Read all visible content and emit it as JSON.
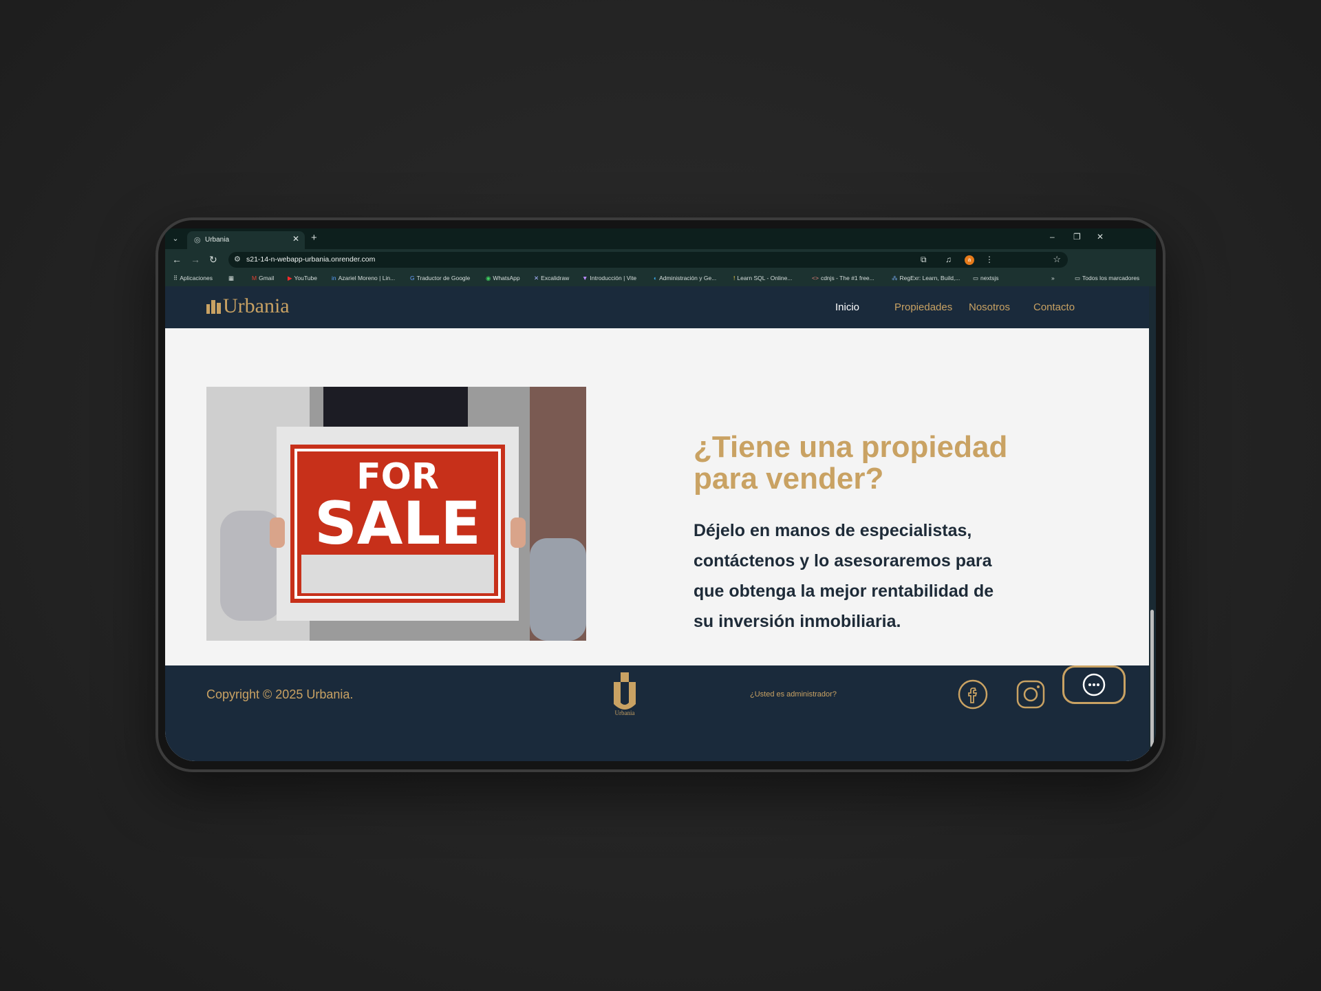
{
  "browser": {
    "tab_title": "Urbania",
    "url": "s21-14-n-webapp-urbania.onrender.com",
    "profile_initial": "a",
    "bookmarks": [
      "Aplicaciones",
      "Gmail",
      "YouTube",
      "Azariel Moreno | Lin...",
      "Traductor de Google",
      "WhatsApp",
      "Excalidraw",
      "Introducción | Vite",
      "Administración y Ge...",
      "Learn SQL - Online...",
      "cdnjs - The #1 free...",
      "RegExr: Learn, Build,...",
      "nextsjs"
    ],
    "all_bookmarks": "Todos los marcadores"
  },
  "site": {
    "brand": "Urbania",
    "nav": [
      "Inicio",
      "Propiedades",
      "Nosotros",
      "Contacto"
    ],
    "active_nav": "Inicio",
    "heading": "¿Tiene una propiedad para vender?",
    "body": "Déjelo en manos de especialistas, contáctenos y lo asesoraremos para que obtenga la mejor rentabilidad de su inversión inmobiliaria.",
    "image_sign": {
      "line1": "FOR",
      "line2": "SALE"
    }
  },
  "footer": {
    "copyright": "Copyright © 2025 Urbania.",
    "logo_caption": "Urbania",
    "admin_link": "¿Usted es administrador?"
  },
  "colors": {
    "gold": "#c9a263",
    "navy": "#1a2a3b",
    "page_bg": "#f4f4f4",
    "sign_red": "#c7301a"
  }
}
